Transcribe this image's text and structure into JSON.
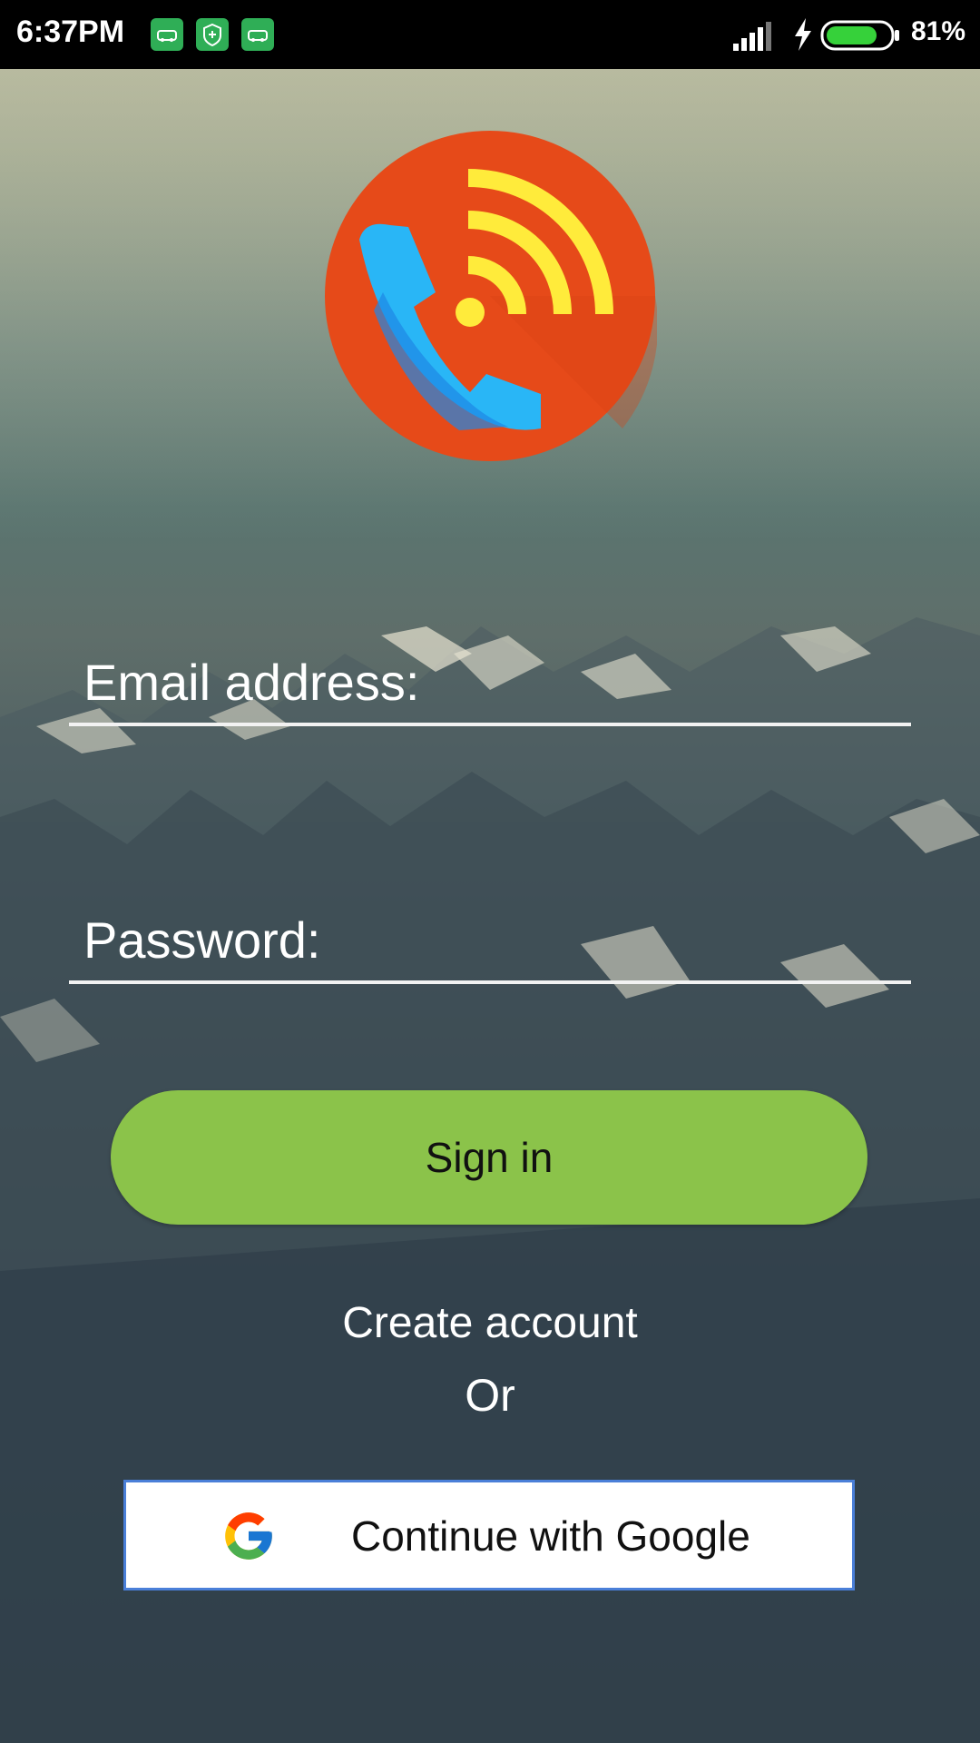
{
  "status_bar": {
    "time": "6:37PM",
    "battery_percent": "81%",
    "notification_icons": [
      "car-icon",
      "shield-icon",
      "car-icon"
    ],
    "signal_icon": "cell-signal-icon",
    "charging_icon": "charging-bolt-icon",
    "battery_icon": "battery-icon",
    "battery_level": 0.81
  },
  "logo": {
    "icon": "phone-broadcast-logo",
    "colors": {
      "circle": "#e64a19",
      "phone": "#29b6f6",
      "signal": "#ffeb3b"
    }
  },
  "form": {
    "email": {
      "placeholder": "Email address:",
      "value": ""
    },
    "password": {
      "placeholder": "Password:",
      "value": ""
    },
    "sign_in_label": "Sign in",
    "create_account_label": "Create account",
    "or_label": "Or",
    "google_label": "Continue with Google"
  },
  "colors": {
    "sign_in_button": "#8bc34a",
    "google_button_border": "#4a7fd8",
    "field_underline": "#f2f2f2"
  }
}
